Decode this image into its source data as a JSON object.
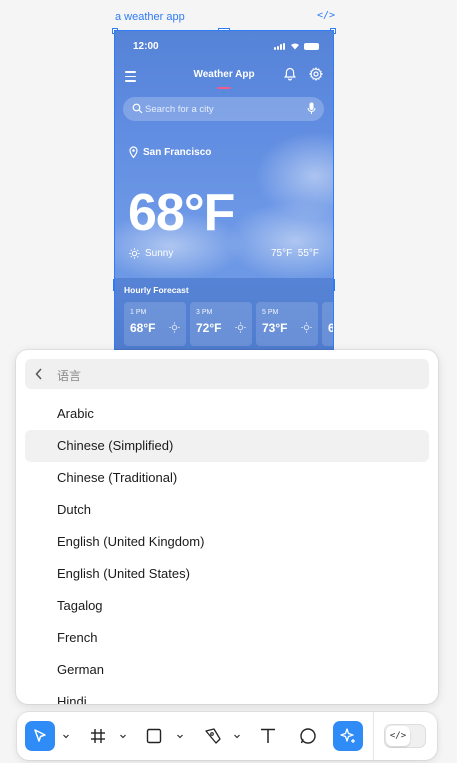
{
  "frame": {
    "label": "a weather app",
    "code_icon": "</>"
  },
  "phone": {
    "status_time": "12:00",
    "app_title": "Weather App",
    "search_placeholder": "Search for a city",
    "location": "San Francisco",
    "temperature": "68°F",
    "condition": "Sunny",
    "hi_lo": "75°F  55°F",
    "hourly_title": "Hourly Forecast",
    "hourly": [
      {
        "time": "1 PM",
        "temp": "68°F"
      },
      {
        "time": "3 PM",
        "temp": "72°F"
      },
      {
        "time": "5 PM",
        "temp": "73°F"
      },
      {
        "time": "",
        "temp": "6"
      }
    ],
    "colors": {
      "accent_underline": "#f05a8c",
      "sky": "#5e8be0"
    }
  },
  "language_menu": {
    "header": "语言",
    "items": [
      "Arabic",
      "Chinese (Simplified)",
      "Chinese (Traditional)",
      "Dutch",
      "English (United Kingdom)",
      "English (United States)",
      "Tagalog",
      "French",
      "German",
      "Hindi"
    ],
    "selected_index": 1
  },
  "toolbar": {
    "tools": [
      "move-tool",
      "frame-tool",
      "shape-tool",
      "pen-tool",
      "text-tool",
      "comment-tool",
      "ai-tool"
    ],
    "dev_mode_icon": "</>",
    "accent": "#2f8cf6"
  }
}
